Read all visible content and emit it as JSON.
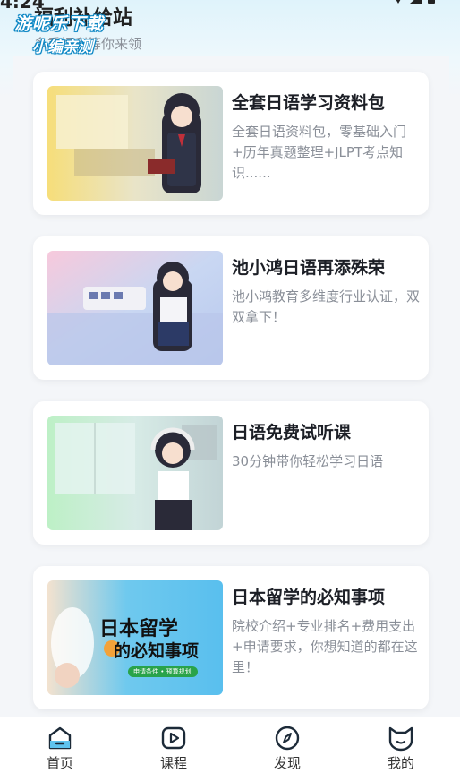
{
  "status_bar": {
    "time": "4:24"
  },
  "watermark": {
    "line1": "游呢乐下载",
    "line2": "小编亲测"
  },
  "header": {
    "title": "福利补给站",
    "subtitle": "多重福利等你来领"
  },
  "cards": [
    {
      "title": "全套日语学习资料包",
      "description": "全套日语资料包，零基础入门+历年真题整理+JLPT考点知识......",
      "image": "anime-girl-reading-book-illustration"
    },
    {
      "title": "池小鸿日语再添殊荣",
      "description": "池小鸿教育多维度行业认证，双双拿下！",
      "image": "anime-girl-train-station-illustration"
    },
    {
      "title": "日语免费试听课",
      "description": "30分钟带你轻松学习日语",
      "image": "anime-girl-headphones-illustration"
    },
    {
      "title": "日本留学的必知事项",
      "description": "院校介绍+专业排名+费用支出+申请要求，你想知道的都在这里！",
      "image": "study-abroad-banner",
      "image_text": {
        "headline_1": "日本留学",
        "headline_2": "的必知事项",
        "tag": "申请条件 • 预算规划"
      }
    }
  ],
  "tabbar": [
    {
      "label": "首页",
      "icon": "home-icon",
      "active": true
    },
    {
      "label": "课程",
      "icon": "play-icon",
      "active": false
    },
    {
      "label": "发现",
      "icon": "compass-icon",
      "active": false
    },
    {
      "label": "我的",
      "icon": "cat-face-icon",
      "active": false
    }
  ],
  "colors": {
    "accent": "#1c2a38",
    "muted_text": "#8a8f98",
    "title_text": "#1c1f26"
  }
}
